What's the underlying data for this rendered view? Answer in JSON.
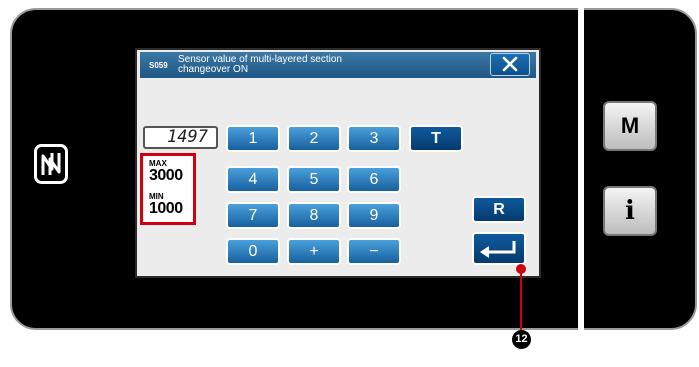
{
  "dialog": {
    "code": "S059",
    "title_line1": "Sensor value of multi-layered section",
    "title_line2": "changeover ON",
    "close_label": "✕"
  },
  "input": {
    "value": "1497"
  },
  "limits": {
    "max_label": "MAX",
    "max_value": "3000",
    "min_label": "MIN",
    "min_value": "1000"
  },
  "keypad": {
    "k1": "1",
    "k2": "2",
    "k3": "3",
    "kT": "T",
    "k4": "4",
    "k5": "5",
    "k6": "6",
    "k7": "7",
    "k8": "8",
    "k9": "9",
    "kR": "R",
    "k0": "0",
    "kplus": "+",
    "kminus": "−"
  },
  "side_buttons": {
    "mode": "M",
    "info": "i"
  },
  "callout": {
    "number": "12"
  },
  "icons": {
    "nfc": "nfc-icon",
    "enter": "enter-arrow-icon",
    "close": "close-icon"
  }
}
